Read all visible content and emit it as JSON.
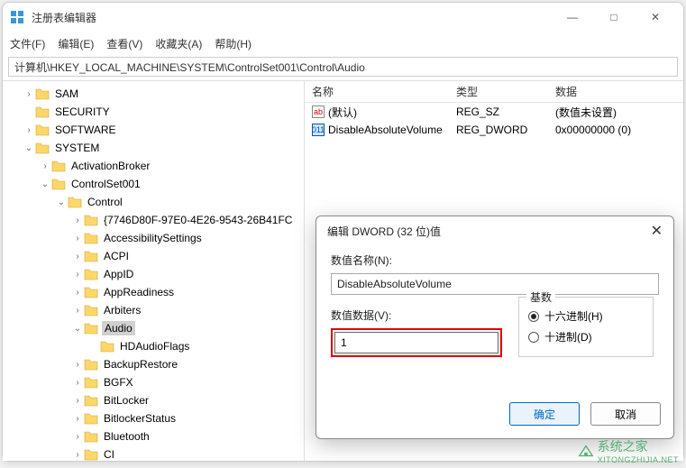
{
  "window": {
    "title": "注册表编辑器",
    "controls": {
      "min": "—",
      "max": "□",
      "close": "✕"
    }
  },
  "menu": {
    "file": "文件(F)",
    "edit": "编辑(E)",
    "view": "查看(V)",
    "favorites": "收藏夹(A)",
    "help": "帮助(H)"
  },
  "address": "计算机\\HKEY_LOCAL_MACHINE\\SYSTEM\\ControlSet001\\Control\\Audio",
  "tree": [
    {
      "indent": 1,
      "caret": ">",
      "label": "SAM"
    },
    {
      "indent": 1,
      "caret": "",
      "label": "SECURITY"
    },
    {
      "indent": 1,
      "caret": ">",
      "label": "SOFTWARE"
    },
    {
      "indent": 1,
      "caret": "v",
      "label": "SYSTEM"
    },
    {
      "indent": 2,
      "caret": ">",
      "label": "ActivationBroker"
    },
    {
      "indent": 2,
      "caret": "v",
      "label": "ControlSet001"
    },
    {
      "indent": 3,
      "caret": "v",
      "label": "Control"
    },
    {
      "indent": 4,
      "caret": ">",
      "label": "{7746D80F-97E0-4E26-9543-26B41FC"
    },
    {
      "indent": 4,
      "caret": ">",
      "label": "AccessibilitySettings"
    },
    {
      "indent": 4,
      "caret": ">",
      "label": "ACPI"
    },
    {
      "indent": 4,
      "caret": ">",
      "label": "AppID"
    },
    {
      "indent": 4,
      "caret": ">",
      "label": "AppReadiness"
    },
    {
      "indent": 4,
      "caret": ">",
      "label": "Arbiters"
    },
    {
      "indent": 4,
      "caret": "v",
      "label": "Audio",
      "selected": true
    },
    {
      "indent": 5,
      "caret": "",
      "label": "HDAudioFlags"
    },
    {
      "indent": 4,
      "caret": ">",
      "label": "BackupRestore"
    },
    {
      "indent": 4,
      "caret": ">",
      "label": "BGFX"
    },
    {
      "indent": 4,
      "caret": ">",
      "label": "BitLocker"
    },
    {
      "indent": 4,
      "caret": ">",
      "label": "BitlockerStatus"
    },
    {
      "indent": 4,
      "caret": ">",
      "label": "Bluetooth"
    },
    {
      "indent": 4,
      "caret": ">",
      "label": "CI"
    }
  ],
  "list": {
    "headers": {
      "name": "名称",
      "type": "类型",
      "data": "数据"
    },
    "rows": [
      {
        "icon": "sz",
        "name": "(默认)",
        "type": "REG_SZ",
        "data": "(数值未设置)"
      },
      {
        "icon": "dw",
        "name": "DisableAbsoluteVolume",
        "type": "REG_DWORD",
        "data": "0x00000000 (0)"
      }
    ]
  },
  "dialog": {
    "title": "编辑 DWORD (32 位)值",
    "name_label": "数值名称(N):",
    "name_value": "DisableAbsoluteVolume",
    "data_label": "数值数据(V):",
    "data_value": "1",
    "radix_label": "基数",
    "hex": "十六进制(H)",
    "dec": "十进制(D)",
    "ok": "确定",
    "cancel": "取消"
  },
  "watermark": {
    "text": "系统之家",
    "url": "XITONGZHIJIA.NET"
  }
}
